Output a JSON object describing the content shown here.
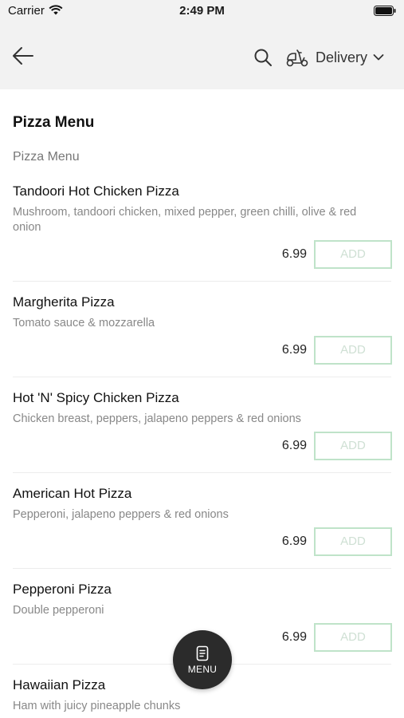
{
  "status_bar": {
    "carrier": "Carrier",
    "time": "2:49 PM"
  },
  "header": {
    "back_icon": "back-arrow-icon",
    "search_icon": "search-icon",
    "delivery_icon": "scooter-icon",
    "delivery_label": "Delivery",
    "chevron_icon": "chevron-down-icon"
  },
  "section_title": "Pizza Menu",
  "category_label": "Pizza Menu",
  "items": [
    {
      "name": "Tandoori Hot Chicken Pizza",
      "description": "Mushroom, tandoori chicken, mixed pepper, green chilli, olive & red onion",
      "price": "6.99",
      "add_label": "ADD"
    },
    {
      "name": "Margherita Pizza",
      "description": "Tomato sauce & mozzarella",
      "price": "6.99",
      "add_label": "ADD"
    },
    {
      "name": "Hot 'N' Spicy Chicken Pizza",
      "description": "Chicken breast, peppers, jalapeno peppers & red onions",
      "price": "6.99",
      "add_label": "ADD"
    },
    {
      "name": "American Hot Pizza",
      "description": "Pepperoni, jalapeno peppers & red onions",
      "price": "6.99",
      "add_label": "ADD"
    },
    {
      "name": "Pepperoni Pizza",
      "description": "Double pepperoni",
      "price": "6.99",
      "add_label": "ADD"
    },
    {
      "name": "Hawaiian Pizza",
      "description": "Ham with juicy pineapple chunks"
    }
  ],
  "fab": {
    "icon": "menu-book-icon",
    "label": "MENU"
  },
  "colors": {
    "header_bg": "#f2f2f2",
    "add_border": "#bfe3c9",
    "fab_bg": "#2b2b2b"
  }
}
